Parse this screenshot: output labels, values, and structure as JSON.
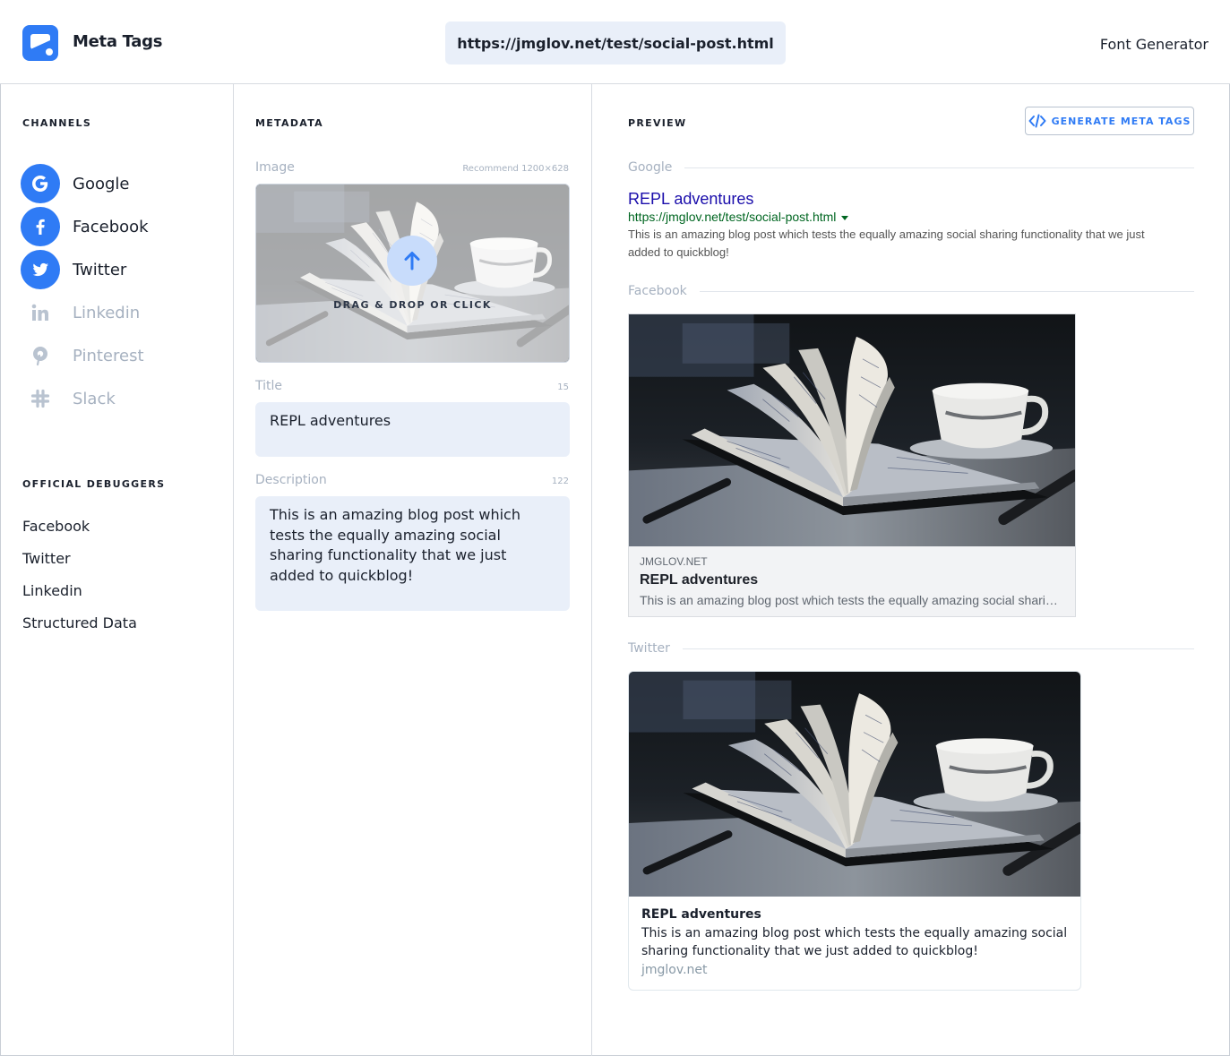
{
  "app": {
    "name": "Meta Tags"
  },
  "header": {
    "url": "https://jmglov.net/test/social-post.html",
    "font_generator": "Font Generator"
  },
  "sidebar": {
    "channels_heading": "CHANNELS",
    "channels": [
      {
        "label": "Google",
        "icon": "google-icon",
        "active": true
      },
      {
        "label": "Facebook",
        "icon": "facebook-icon",
        "active": true
      },
      {
        "label": "Twitter",
        "icon": "twitter-icon",
        "active": true
      },
      {
        "label": "Linkedin",
        "icon": "linkedin-icon",
        "active": false
      },
      {
        "label": "Pinterest",
        "icon": "pinterest-icon",
        "active": false
      },
      {
        "label": "Slack",
        "icon": "slack-icon",
        "active": false
      }
    ],
    "debuggers_heading": "OFFICIAL DEBUGGERS",
    "debuggers": [
      "Facebook",
      "Twitter",
      "Linkedin",
      "Structured Data"
    ]
  },
  "metadata": {
    "heading": "METADATA",
    "image_label": "Image",
    "image_hint": "Recommend 1200×628",
    "drop_text": "DRAG & DROP OR CLICK",
    "title_label": "Title",
    "title_count": "15",
    "title_value": "REPL adventures",
    "description_label": "Description",
    "description_count": "122",
    "description_value": "This is an amazing blog post which tests the equally amazing social sharing functionality that we just added to quickblog!"
  },
  "preview": {
    "heading": "PREVIEW",
    "generate_button": "GENERATE META TAGS",
    "google_label": "Google",
    "google": {
      "title": "REPL adventures",
      "url": "https://jmglov.net/test/social-post.html",
      "description": "This is an amazing blog post which tests the equally amazing social sharing functionality that we just added to quickblog!"
    },
    "facebook_label": "Facebook",
    "facebook": {
      "domain": "JMGLOV.NET",
      "title": "REPL adventures",
      "description": "This is an amazing blog post which tests the equally amazing social sharing functionality that we just added to quickblog!"
    },
    "twitter_label": "Twitter",
    "twitter": {
      "title": "REPL adventures",
      "description": "This is an amazing blog post which tests the equally amazing social sharing functionality that we just added to quickblog!",
      "domain": "jmglov.net"
    }
  },
  "colors": {
    "accent": "#2f7bf5",
    "muted": "#a6b1c0",
    "input_bg": "#e9eff9",
    "google_title": "#1a0dab",
    "google_url": "#006621"
  }
}
